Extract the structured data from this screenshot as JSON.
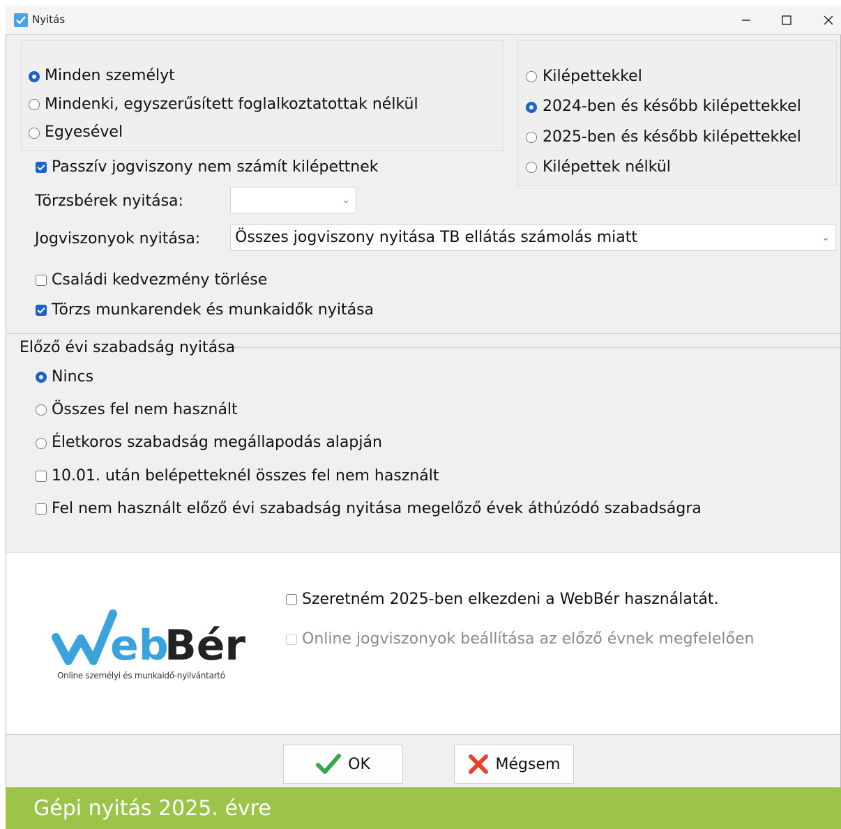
{
  "window": {
    "title": "Nyitás",
    "controls": [
      "minimize",
      "maximize",
      "close"
    ]
  },
  "scope_group": {
    "options": [
      "Minden személyt",
      "Mindenki, egyszerűsített foglalkoztatottak nélkül",
      "Egyesével"
    ],
    "selected": "Minden személyt"
  },
  "leavers_group": {
    "options": [
      "Kilépettekkel",
      "2024-ben és később kilépettekkel",
      "2025-ben és később kilépettekkel",
      "Kilépettek nélkül"
    ],
    "selected": "2024-ben és később kilépettekkel"
  },
  "passive_checkbox": {
    "label": "Passzív jogviszony nem számít kilépettnek",
    "checked": true
  },
  "torzsberek": {
    "label": "Törzsbérek nyitása:",
    "value": ""
  },
  "jogviszonyok": {
    "label": "Jogviszonyok nyitása:",
    "value": "Összes jogviszony nyitása TB ellátás számolás miatt"
  },
  "csaladi_checkbox": {
    "label": "Családi kedvezmény törlése",
    "checked": false
  },
  "torzs_munkarend_checkbox": {
    "label": "Törzs munkarendek és munkaidők nyitása",
    "checked": true
  },
  "vacation_section": {
    "title": "Előző évi szabadság nyitása",
    "radios": [
      "Nincs",
      "Összes fel nem használt",
      "Életkoros szabadság megállapodás alapján"
    ],
    "selected": "Nincs",
    "checkboxes": [
      {
        "label": "10.01. után belépetteknél összes fel nem használt",
        "checked": false
      },
      {
        "label": "Fel nem használt előző évi szabadság nyitása megelőző évek áthúzódó szabadságra",
        "checked": false
      }
    ]
  },
  "webber": {
    "logo_text": "WebBér",
    "logo_tagline": "Online személyi és munkaidő-nyilvántartó",
    "start_checkbox": {
      "label": "Szeretném 2025-ben elkezdeni a WebBér használatát.",
      "checked": false
    },
    "online_checkbox": {
      "label": "Online jogviszonyok beállítása az előző évnek megfelelően",
      "checked": false,
      "disabled": true
    }
  },
  "buttons": {
    "ok": "OK",
    "cancel": "Mégsem"
  },
  "caption": "Gépi nyitás 2025. évre",
  "colors": {
    "accent": "#1a63c7",
    "caption_bar": "#9cc44a",
    "ok_icon": "#3aa64a",
    "cancel_icon": "#e8412c",
    "logo_blue": "#3aa3dc"
  }
}
